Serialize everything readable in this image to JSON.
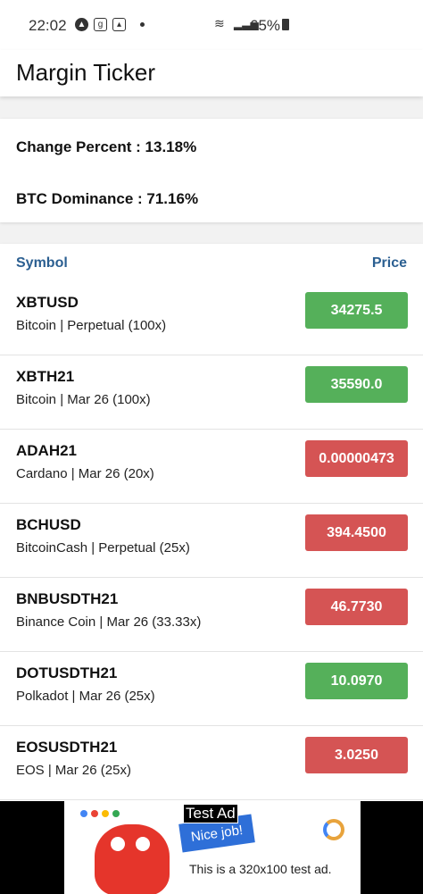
{
  "status_bar": {
    "time": "22:02",
    "battery": "65%"
  },
  "app": {
    "title": "Margin Ticker"
  },
  "summary": {
    "change_percent": "Change Percent : 13.18%",
    "btc_dominance": "BTC Dominance : 71.16%"
  },
  "table": {
    "headers": {
      "symbol": "Symbol",
      "price": "Price"
    },
    "rows": [
      {
        "symbol": "XBTUSD",
        "desc": "Bitcoin | Perpetual (100x)",
        "price": "34275.5",
        "trend": "up"
      },
      {
        "symbol": "XBTH21",
        "desc": "Bitcoin | Mar 26 (100x)",
        "price": "35590.0",
        "trend": "up"
      },
      {
        "symbol": "ADAH21",
        "desc": "Cardano | Mar 26 (20x)",
        "price": "0.00000473",
        "trend": "down"
      },
      {
        "symbol": "BCHUSD",
        "desc": "BitcoinCash | Perpetual (25x)",
        "price": "394.4500",
        "trend": "down"
      },
      {
        "symbol": "BNBUSDTH21",
        "desc": "Binance Coin | Mar 26 (33.33x)",
        "price": "46.7730",
        "trend": "down"
      },
      {
        "symbol": "DOTUSDTH21",
        "desc": "Polkadot | Mar 26 (25x)",
        "price": "10.0970",
        "trend": "up"
      },
      {
        "symbol": "EOSUSDTH21",
        "desc": "EOS | Mar 26 (25x)",
        "price": "3.0250",
        "trend": "down"
      }
    ]
  },
  "ad": {
    "label": "Test Ad",
    "nice": "Nice job!",
    "text": "This is a 320x100 test ad."
  },
  "colors": {
    "up": "#55b05a",
    "down": "#d55454",
    "header_text": "#2b5f91"
  }
}
